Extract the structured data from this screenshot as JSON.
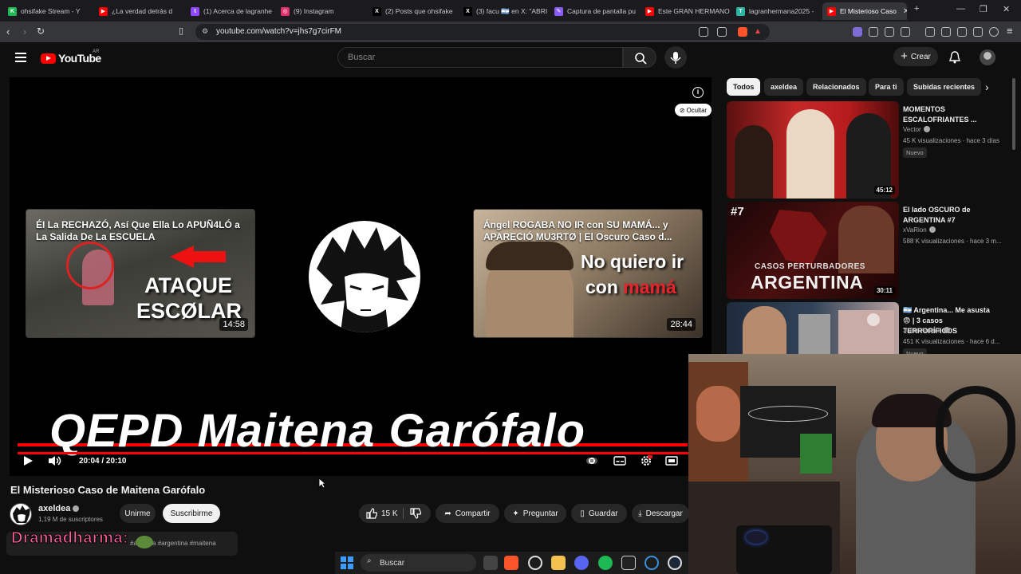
{
  "browser": {
    "tabs": [
      {
        "title": "ohsifake Stream - Y",
        "color": "#1db954",
        "glyph": "K"
      },
      {
        "title": "¿La verdad detrás d",
        "color": "#ff0000",
        "glyph": "▶"
      },
      {
        "title": "(1) Acerca de lagranhe",
        "color": "#9146ff",
        "glyph": "t"
      },
      {
        "title": "(9) Instagram",
        "color": "#e1306c",
        "glyph": "◎"
      },
      {
        "title": "(2) Posts que ohsifake",
        "color": "#000000",
        "glyph": "X"
      },
      {
        "title": "(3) facu 🇦🇷 en X: \"ABRI",
        "color": "#000000",
        "glyph": "X"
      },
      {
        "title": "Captura de pantalla pu",
        "color": "#8a5cf6",
        "glyph": "✎"
      },
      {
        "title": "Este GRAN HERMANO",
        "color": "#ff0000",
        "glyph": "▶"
      },
      {
        "title": "lagranhermana2025 -",
        "color": "#2bb5a3",
        "glyph": "T"
      },
      {
        "title": "El Misterioso Caso",
        "color": "#ff0000",
        "glyph": "▶"
      }
    ],
    "new_tab": "+",
    "url": "youtube.com/watch?v=jhs7g7cirFM"
  },
  "yt": {
    "logo": "YouTube",
    "region": "AR",
    "search_placeholder": "Buscar",
    "create_label": "Crear"
  },
  "player": {
    "hide_label": "Ocultar",
    "endcard_left": {
      "title": "ÉI La RECHAZÓ, Así Que Ella Lo APUÑ4LÓ a La Salida De La ESCUELA",
      "overlay_line1": "ATAQUE",
      "overlay_line2": "ESCØLAR",
      "duration": "14:58"
    },
    "endcard_right": {
      "title": "Ángel ROGABA NO IR con SU MAMÁ... y APARECIÓ MU3RTØ | El Oscuro Caso d...",
      "overlay_line1": "No quiero ir",
      "overlay_line2a": "con ",
      "overlay_line2b": "mamá",
      "duration": "28:44"
    },
    "big_title": "QEPD Maitena Garófalo",
    "time": "20:04 / 20:10",
    "progress": 0.995
  },
  "video": {
    "title": "El Misterioso Caso de Maitena Garófalo",
    "channel": "axeldea",
    "subscribers": "1,19 M de suscriptores",
    "unsubscribe_label": "Unirme",
    "subscribe_label": "Suscribirme",
    "likes": "15 K",
    "share_label": "Compartir",
    "ask_label": "Preguntar",
    "save_label": "Guardar",
    "download_label": "Descargar",
    "hashtags": "#axeldea #argentina #maitena",
    "overlay_text": "Dramadharma:"
  },
  "sidebar": {
    "chips": [
      "Todos",
      "axeldea",
      "Relacionados",
      "Para ti",
      "Subidas recientes"
    ],
    "videos": [
      {
        "title": "MOMENTOS ESCALOFRIANTES ...",
        "channel": "Vector",
        "meta": "45 K visualizaciones · hace 3 días",
        "badge": "Nuevo",
        "duration": "45:12"
      },
      {
        "title": "El lado OSCURO de ARGENTINA #7",
        "channel": "xVaRion",
        "meta": "588 K visualizaciones · hace 3 m...",
        "badge": "",
        "duration": "30:11",
        "thumb_tag": "#7",
        "thumb_line1": "CASOS PERTURBADORES",
        "thumb_line2": "ARGENTINA"
      },
      {
        "title": "🇦🇷 Argentina... Me asusta 😨 | 3 casos TERRORÍFICOS",
        "channel": "Julian Abdala",
        "meta": "451 K visualizaciones · hace 6 d...",
        "badge": "Nuevo",
        "duration": ""
      }
    ]
  },
  "taskbar": {
    "search_label": "Buscar"
  }
}
